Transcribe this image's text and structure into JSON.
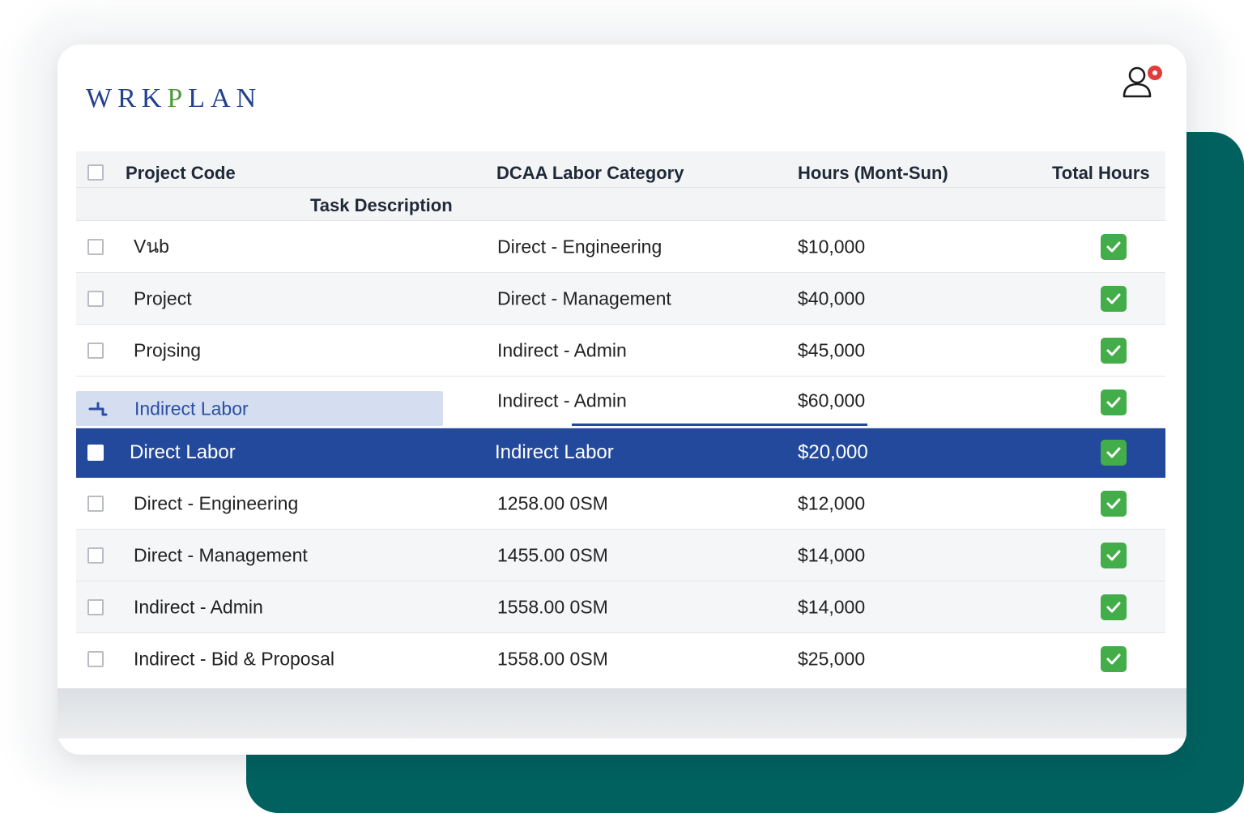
{
  "brand": {
    "logo_pre": "WRK",
    "logo_p": "P",
    "logo_post": "LAN",
    "accent": "#23418f",
    "accent_green": "#4e9b3d"
  },
  "header": {
    "user_icon": "user-icon",
    "notification_color": "#e23b3b"
  },
  "table": {
    "columns": {
      "project_code": "Project Code",
      "task_description": "Task Description",
      "labor_category": "DCAA Labor Category",
      "hours": "Hours (Mont-Sun)",
      "total_hours": "Total Hours"
    },
    "rows": [
      {
        "code": "Vนb",
        "category": "Direct - Engineering",
        "amount": "$10,000",
        "checked": true
      },
      {
        "code": "Project",
        "category": "Direct - Management",
        "amount": "$40,000",
        "checked": true
      },
      {
        "code": "Projsing",
        "category": "Indirect - Admin",
        "amount": "$45,000",
        "checked": true
      },
      {
        "code": "Indirect Labor",
        "category": "Indirect - Admin",
        "amount": "$60,000",
        "checked": true,
        "dragging": true
      },
      {
        "code": "Direct Labor",
        "category": "Indirect Labor",
        "amount": "$20,000",
        "checked": true,
        "selected": true
      },
      {
        "code": "Direct - Engineering",
        "category": "1258.00 0SM",
        "amount": "$12,000",
        "checked": true
      },
      {
        "code": "Direct - Management",
        "category": "1455.00 0SM",
        "amount": "$14,000",
        "checked": true
      },
      {
        "code": "Indirect - Admin",
        "category": "1558.00 0SM",
        "amount": "$14,000",
        "checked": true
      },
      {
        "code": "Indirect - Bid & Proposal",
        "category": "1558.00 0SM",
        "amount": "$25,000",
        "checked": true
      }
    ],
    "selected_color": "#23499c",
    "check_color": "#43ad49"
  }
}
